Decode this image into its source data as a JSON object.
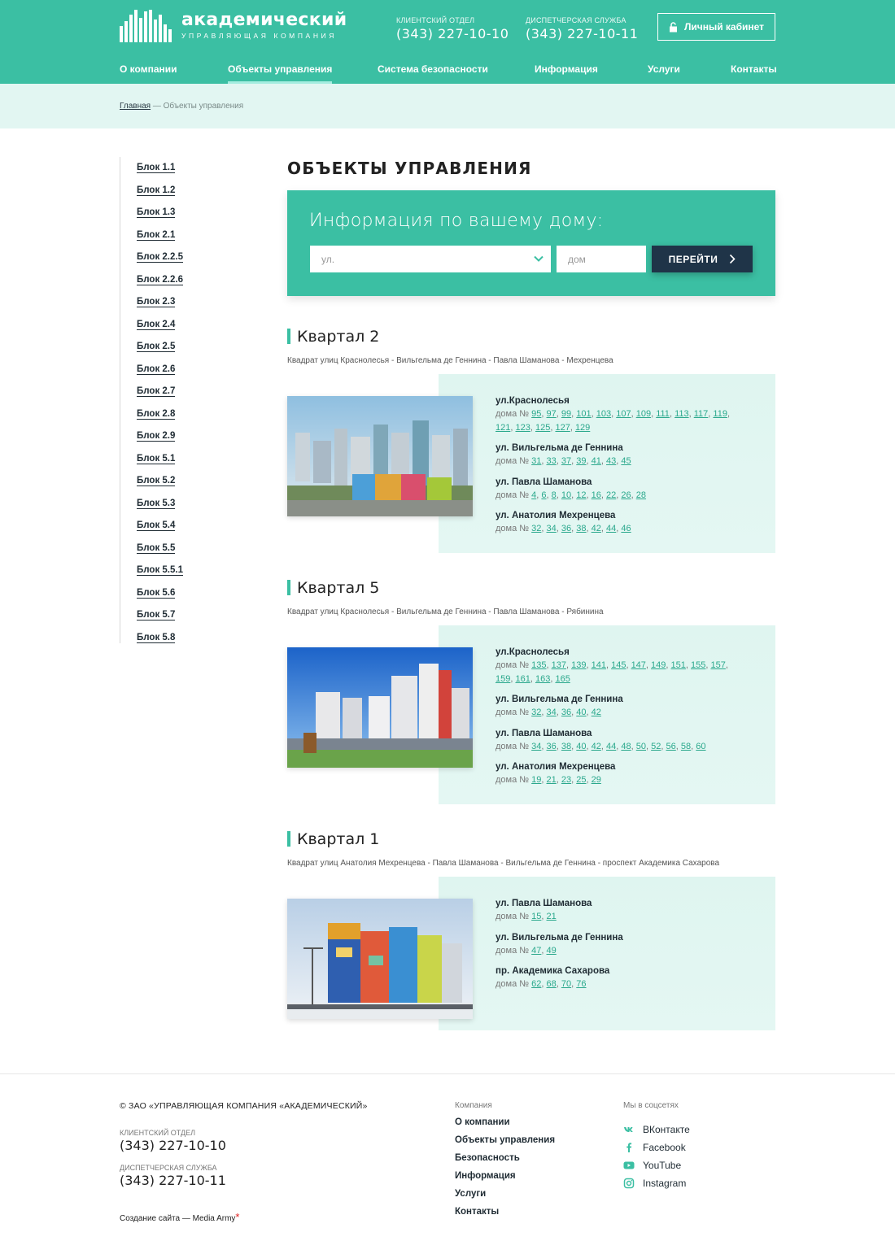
{
  "logo": {
    "name": "академический",
    "sub": "управляющая компания"
  },
  "header": {
    "phones": [
      {
        "label": "КЛИЕНТСКИЙ ОТДЕЛ",
        "number": "(343) 227-10-10"
      },
      {
        "label": "ДИСПЕТЧЕРСКАЯ СЛУЖБА",
        "number": "(343) 227-10-11"
      }
    ],
    "cabinet": "Личный кабинет"
  },
  "nav": [
    "О компании",
    "Объекты управления",
    "Система безопасности",
    "Информация",
    "Услуги",
    "Контакты"
  ],
  "breadcrumb": {
    "home": "Главная",
    "current": "— Объекты управления"
  },
  "sidebar": [
    "Блок 1.1",
    "Блок 1.2",
    "Блок 1.3",
    "Блок 2.1",
    "Блок 2.2.5",
    "Блок 2.2.6",
    "Блок 2.3",
    "Блок 2.4",
    "Блок 2.5",
    "Блок 2.6",
    "Блок 2.7",
    "Блок 2.8",
    "Блок 2.9",
    "Блок 5.1",
    "Блок 5.2",
    "Блок 5.3",
    "Блок 5.4",
    "Блок 5.5",
    "Блок 5.5.1",
    "Блок 5.6",
    "Блок 5.7",
    "Блок 5.8"
  ],
  "page_title": "ОБЪЕКТЫ УПРАВЛЕНИЯ",
  "search": {
    "title": "Информация по вашему дому:",
    "street_placeholder": "ул.",
    "house_placeholder": "дом",
    "button": "ПЕРЕЙТИ"
  },
  "quarters": [
    {
      "title": "Квартал 2",
      "sub": "Квадрат улиц Краснолесья - Вильгельма де Геннина - Павла Шаманова - Мехренцева",
      "streets": [
        {
          "name": "ул.Краснолесья",
          "prefix": "дома №",
          "houses": [
            "95",
            "97",
            "99",
            "101",
            "103",
            "107",
            "109",
            "111",
            "113",
            "117",
            "119",
            "121",
            "123",
            "125",
            "127",
            "129"
          ]
        },
        {
          "name": "ул. Вильгельма де Геннина",
          "prefix": "дома №",
          "houses": [
            "31",
            "33",
            "37",
            "39",
            "41",
            "43",
            "45"
          ]
        },
        {
          "name": "ул. Павла Шаманова",
          "prefix": "дома №",
          "houses": [
            "4",
            "6",
            "8",
            "10",
            "12",
            "16",
            "22",
            "26",
            "28"
          ]
        },
        {
          "name": "ул. Анатолия Мехренцева",
          "prefix": "дома №",
          "houses": [
            "32",
            "34",
            "36",
            "38",
            "42",
            "44",
            "46"
          ]
        }
      ]
    },
    {
      "title": "Квартал 5",
      "sub": "Квадрат улиц Краснолесья - Вильгельма де Геннина - Павла Шаманова - Рябинина",
      "streets": [
        {
          "name": "ул.Краснолесья",
          "prefix": "дома №",
          "houses": [
            "135",
            "137",
            "139",
            "141",
            "145",
            "147",
            "149",
            "151",
            "155",
            "157",
            "159",
            "161",
            "163",
            "165"
          ]
        },
        {
          "name": "ул. Вильгельма де Геннина",
          "prefix": "дома №",
          "houses": [
            "32",
            "34",
            "36",
            "40",
            "42"
          ]
        },
        {
          "name": "ул. Павла Шаманова",
          "prefix": "дома №",
          "houses": [
            "34",
            "36",
            "38",
            "40",
            "42",
            "44",
            "48",
            "50",
            "52",
            "56",
            "58",
            "60"
          ]
        },
        {
          "name": "ул. Анатолия Мехренцева",
          "prefix": "дома №",
          "houses": [
            "19",
            "21",
            "23",
            "25",
            "29"
          ]
        }
      ]
    },
    {
      "title": "Квартал 1",
      "sub": "Квадрат улиц Анатолия Мехренцева - Павла Шаманова - Вильгельма де Геннина - проспект Академика Сахарова",
      "streets": [
        {
          "name": "ул. Павла Шаманова",
          "prefix": "дома №",
          "houses": [
            "15",
            "21"
          ]
        },
        {
          "name": "ул. Вильгельма де Геннина",
          "prefix": "дома №",
          "houses": [
            "47",
            "49"
          ]
        },
        {
          "name": "пр. Академика Сахарова",
          "prefix": "дома №",
          "houses": [
            "62",
            "68",
            "70",
            "76"
          ]
        }
      ]
    }
  ],
  "footer": {
    "copyright": "© ЗАО «УПРАВЛЯЮЩАЯ КОМПАНИЯ «АКАДЕМИЧЕСКИЙ»",
    "phones": [
      {
        "label": "КЛИЕНТСКИЙ ОТДЕЛ",
        "number": "(343) 227-10-10"
      },
      {
        "label": "ДИСПЕТЧЕРСКАЯ СЛУЖБА",
        "number": "(343) 227-10-11"
      }
    ],
    "credit": "Создание сайта — Media Army",
    "company_title": "Компания",
    "company_links": [
      "О компании",
      "Объекты управления",
      "Безопасность",
      "Информация",
      "Услуги",
      "Контакты"
    ],
    "social_title": "Мы в соцсетях",
    "social": [
      {
        "label": "ВКонтакте",
        "icon": "vk-icon"
      },
      {
        "label": "Facebook",
        "icon": "facebook-icon"
      },
      {
        "label": "YouTube",
        "icon": "youtube-icon"
      },
      {
        "label": "Instagram",
        "icon": "instagram-icon"
      }
    ]
  },
  "colors": {
    "accent": "#3bbfa3",
    "dark": "#1f3448",
    "link": "#2aa88c",
    "panel": "#e0f5f1"
  }
}
